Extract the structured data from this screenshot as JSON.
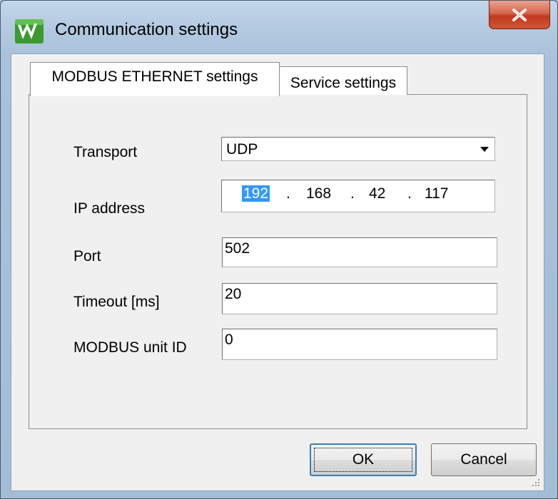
{
  "window": {
    "title": "Communication settings"
  },
  "tabs": [
    {
      "label": "MODBUS ETHERNET settings",
      "active": true
    },
    {
      "label": "Service settings",
      "active": false
    }
  ],
  "form": {
    "transport": {
      "label": "Transport",
      "value": "UDP"
    },
    "ip_address": {
      "label": "IP address",
      "octets": [
        "192",
        "168",
        "42",
        "117"
      ],
      "separator": "."
    },
    "port": {
      "label": "Port",
      "value": "502"
    },
    "timeout": {
      "label": "Timeout [ms]",
      "value": "20"
    },
    "unit_id": {
      "label": "MODBUS unit ID",
      "value": "0"
    }
  },
  "buttons": {
    "ok_label": "OK",
    "cancel_label": "Cancel"
  },
  "icons": {
    "app": "app-w-icon",
    "close": "close-icon",
    "dropdown": "dropdown-arrow-icon",
    "grip": "resize-grip-icon"
  },
  "colors": {
    "selection": "#3399ff",
    "close_button": "#c2391e",
    "app_icon": "#3a9a2e"
  }
}
